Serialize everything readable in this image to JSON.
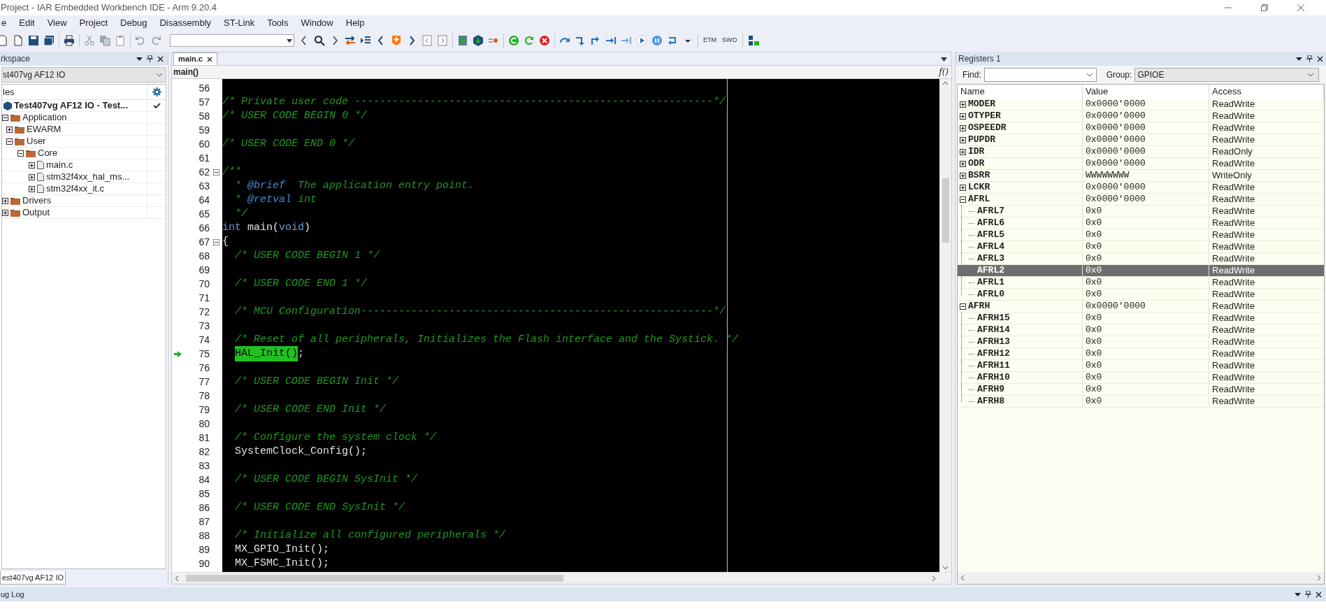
{
  "window": {
    "title": "Project - IAR Embedded Workbench IDE - Arm 9.20.4"
  },
  "menu": [
    "e",
    "Edit",
    "View",
    "Project",
    "Debug",
    "Disassembly",
    "ST-Link",
    "Tools",
    "Window",
    "Help"
  ],
  "toolbar": {
    "labels": [
      "ETM",
      "SWO"
    ]
  },
  "workspace": {
    "title": "rkspace",
    "configuration": "st407vg AF12 IO",
    "column": "les",
    "bottom_tab": "est407vg AF12 IO",
    "tree": [
      {
        "label": "Test407vg AF12 IO - Test...",
        "kind": "project",
        "active": true,
        "children": [
          {
            "label": "Application",
            "kind": "folder",
            "expanded": true,
            "children": [
              {
                "label": "EWARM",
                "kind": "folder",
                "expanded": false
              },
              {
                "label": "User",
                "kind": "folder",
                "expanded": true,
                "children": [
                  {
                    "label": "Core",
                    "kind": "folder",
                    "expanded": true,
                    "children": [
                      {
                        "label": "main.c",
                        "kind": "file",
                        "expanded": false
                      },
                      {
                        "label": "stm32f4xx_hal_ms...",
                        "kind": "file",
                        "expanded": false
                      },
                      {
                        "label": "stm32f4xx_it.c",
                        "kind": "file",
                        "expanded": false
                      }
                    ]
                  }
                ]
              }
            ]
          },
          {
            "label": "Drivers",
            "kind": "folder",
            "expanded": false
          },
          {
            "label": "Output",
            "kind": "folder",
            "expanded": false
          }
        ]
      }
    ]
  },
  "editor": {
    "tabs": [
      {
        "label": "main.c",
        "selected": true
      }
    ],
    "function": "main()",
    "function_button": "f()",
    "lines": [
      {
        "number": "56"
      },
      {
        "number": "57",
        "segments": [
          {
            "text": "/* Private user code ---------------------------------------------------------*/",
            "kind": "comment"
          }
        ]
      },
      {
        "number": "58",
        "segments": [
          {
            "text": "/* USER CODE BEGIN 0 */",
            "kind": "comment"
          }
        ]
      },
      {
        "number": "59"
      },
      {
        "number": "60",
        "segments": [
          {
            "text": "/* USER CODE END 0 */",
            "kind": "comment"
          }
        ]
      },
      {
        "number": "61"
      },
      {
        "number": "62",
        "fold_expanded": true,
        "segments": [
          {
            "text": "/**",
            "kind": "comment"
          }
        ]
      },
      {
        "number": "63",
        "segments": [
          {
            "text": "  * ",
            "kind": "comment"
          },
          {
            "text": "@brief",
            "kind": "tag"
          },
          {
            "text": "  The application entry point.",
            "kind": "comment"
          }
        ]
      },
      {
        "number": "64",
        "segments": [
          {
            "text": "  * ",
            "kind": "comment"
          },
          {
            "text": "@retval",
            "kind": "tag"
          },
          {
            "text": " int",
            "kind": "comment"
          }
        ]
      },
      {
        "number": "65",
        "segments": [
          {
            "text": "  */",
            "kind": "comment"
          }
        ]
      },
      {
        "number": "66",
        "segments": [
          {
            "text": "int",
            "kind": "keyword"
          },
          {
            "text": " main(",
            "kind": "plain"
          },
          {
            "text": "void",
            "kind": "keyword"
          },
          {
            "text": ")",
            "kind": "plain"
          }
        ]
      },
      {
        "number": "67",
        "fold_expanded": true,
        "segments": [
          {
            "text": "{",
            "kind": "plain"
          }
        ]
      },
      {
        "number": "68",
        "segments": [
          {
            "text": "  /* USER CODE BEGIN 1 */",
            "kind": "comment"
          }
        ]
      },
      {
        "number": "69"
      },
      {
        "number": "70",
        "segments": [
          {
            "text": "  /* USER CODE END 1 */",
            "kind": "comment"
          }
        ]
      },
      {
        "number": "71"
      },
      {
        "number": "72",
        "segments": [
          {
            "text": "  /* MCU Configuration--------------------------------------------------------*/",
            "kind": "comment"
          }
        ]
      },
      {
        "number": "73"
      },
      {
        "number": "74",
        "segments": [
          {
            "text": "  /* Reset of all peripherals, Initializes the Flash interface and the Systick. */",
            "kind": "comment"
          }
        ]
      },
      {
        "number": "75",
        "current": true,
        "indented": true,
        "segments": [
          {
            "text": "HAL_Init()",
            "kind": "highlight"
          },
          {
            "text": ";",
            "kind": "plain"
          }
        ]
      },
      {
        "number": "76"
      },
      {
        "number": "77",
        "segments": [
          {
            "text": "  /* USER CODE BEGIN Init */",
            "kind": "comment"
          }
        ]
      },
      {
        "number": "78"
      },
      {
        "number": "79",
        "segments": [
          {
            "text": "  /* USER CODE END Init */",
            "kind": "comment"
          }
        ]
      },
      {
        "number": "80"
      },
      {
        "number": "81",
        "segments": [
          {
            "text": "  /* Configure the system clock */",
            "kind": "comment"
          }
        ]
      },
      {
        "number": "82",
        "segments": [
          {
            "text": "  SystemClock_Config();",
            "kind": "plain"
          }
        ]
      },
      {
        "number": "83"
      },
      {
        "number": "84",
        "segments": [
          {
            "text": "  /* USER CODE BEGIN SysInit */",
            "kind": "comment"
          }
        ]
      },
      {
        "number": "85"
      },
      {
        "number": "86",
        "segments": [
          {
            "text": "  /* USER CODE END SysInit */",
            "kind": "comment"
          }
        ]
      },
      {
        "number": "87"
      },
      {
        "number": "88",
        "segments": [
          {
            "text": "  /* Initialize all configured peripherals */",
            "kind": "comment"
          }
        ]
      },
      {
        "number": "89",
        "segments": [
          {
            "text": "  MX_GPIO_Init();",
            "kind": "plain"
          }
        ]
      },
      {
        "number": "90",
        "segments": [
          {
            "text": "  MX_FSMC_Init();",
            "kind": "plain"
          }
        ]
      }
    ]
  },
  "registers": {
    "title": "Registers 1",
    "find_label": "Find:",
    "group_label": "Group:",
    "group": "GPIOE",
    "columns": [
      "Name",
      "Value",
      "Access"
    ],
    "rows": [
      {
        "name": "MODER",
        "value": "0x0000'0000",
        "access": "ReadWrite",
        "expanded": false,
        "selected": false
      },
      {
        "name": "OTYPER",
        "value": "0x0000'0000",
        "access": "ReadWrite",
        "expanded": false,
        "selected": false
      },
      {
        "name": "OSPEEDR",
        "value": "0x0000'0000",
        "access": "ReadWrite",
        "expanded": false,
        "selected": false
      },
      {
        "name": "PUPDR",
        "value": "0x0000'0000",
        "access": "ReadWrite",
        "expanded": false,
        "selected": false
      },
      {
        "name": "IDR",
        "value": "0x0000'0000",
        "access": "ReadOnly",
        "expanded": false,
        "selected": false
      },
      {
        "name": "ODR",
        "value": "0x0000'0000",
        "access": "ReadWrite",
        "expanded": false,
        "selected": false
      },
      {
        "name": "BSRR",
        "value": "WWWWWWWW",
        "access": "WriteOnly",
        "expanded": false,
        "selected": false
      },
      {
        "name": "LCKR",
        "value": "0x0000'0000",
        "access": "ReadWrite",
        "expanded": false,
        "selected": false
      },
      {
        "name": "AFRL",
        "value": "0x0000'0000",
        "access": "ReadWrite",
        "expanded": true,
        "selected": false,
        "children": [
          {
            "name": "AFRL7",
            "value": "0x0",
            "access": "ReadWrite",
            "selected": false
          },
          {
            "name": "AFRL6",
            "value": "0x0",
            "access": "ReadWrite",
            "selected": false
          },
          {
            "name": "AFRL5",
            "value": "0x0",
            "access": "ReadWrite",
            "selected": false
          },
          {
            "name": "AFRL4",
            "value": "0x0",
            "access": "ReadWrite",
            "selected": false
          },
          {
            "name": "AFRL3",
            "value": "0x0",
            "access": "ReadWrite",
            "selected": false
          },
          {
            "name": "AFRL2",
            "value": "0x0",
            "access": "ReadWrite",
            "selected": true
          },
          {
            "name": "AFRL1",
            "value": "0x0",
            "access": "ReadWrite",
            "selected": false
          },
          {
            "name": "AFRL0",
            "value": "0x0",
            "access": "ReadWrite",
            "selected": false
          }
        ]
      },
      {
        "name": "AFRH",
        "value": "0x0000'0000",
        "access": "ReadWrite",
        "expanded": true,
        "selected": false,
        "children": [
          {
            "name": "AFRH15",
            "value": "0x0",
            "access": "ReadWrite",
            "selected": false
          },
          {
            "name": "AFRH14",
            "value": "0x0",
            "access": "ReadWrite",
            "selected": false
          },
          {
            "name": "AFRH13",
            "value": "0x0",
            "access": "ReadWrite",
            "selected": false
          },
          {
            "name": "AFRH12",
            "value": "0x0",
            "access": "ReadWrite",
            "selected": false
          },
          {
            "name": "AFRH11",
            "value": "0x0",
            "access": "ReadWrite",
            "selected": false
          },
          {
            "name": "AFRH10",
            "value": "0x0",
            "access": "ReadWrite",
            "selected": false
          },
          {
            "name": "AFRH9",
            "value": "0x0",
            "access": "ReadWrite",
            "selected": false
          },
          {
            "name": "AFRH8",
            "value": "0x0",
            "access": "ReadWrite",
            "selected": false
          }
        ]
      }
    ]
  },
  "bottom_panel": {
    "title": "ug Log"
  }
}
